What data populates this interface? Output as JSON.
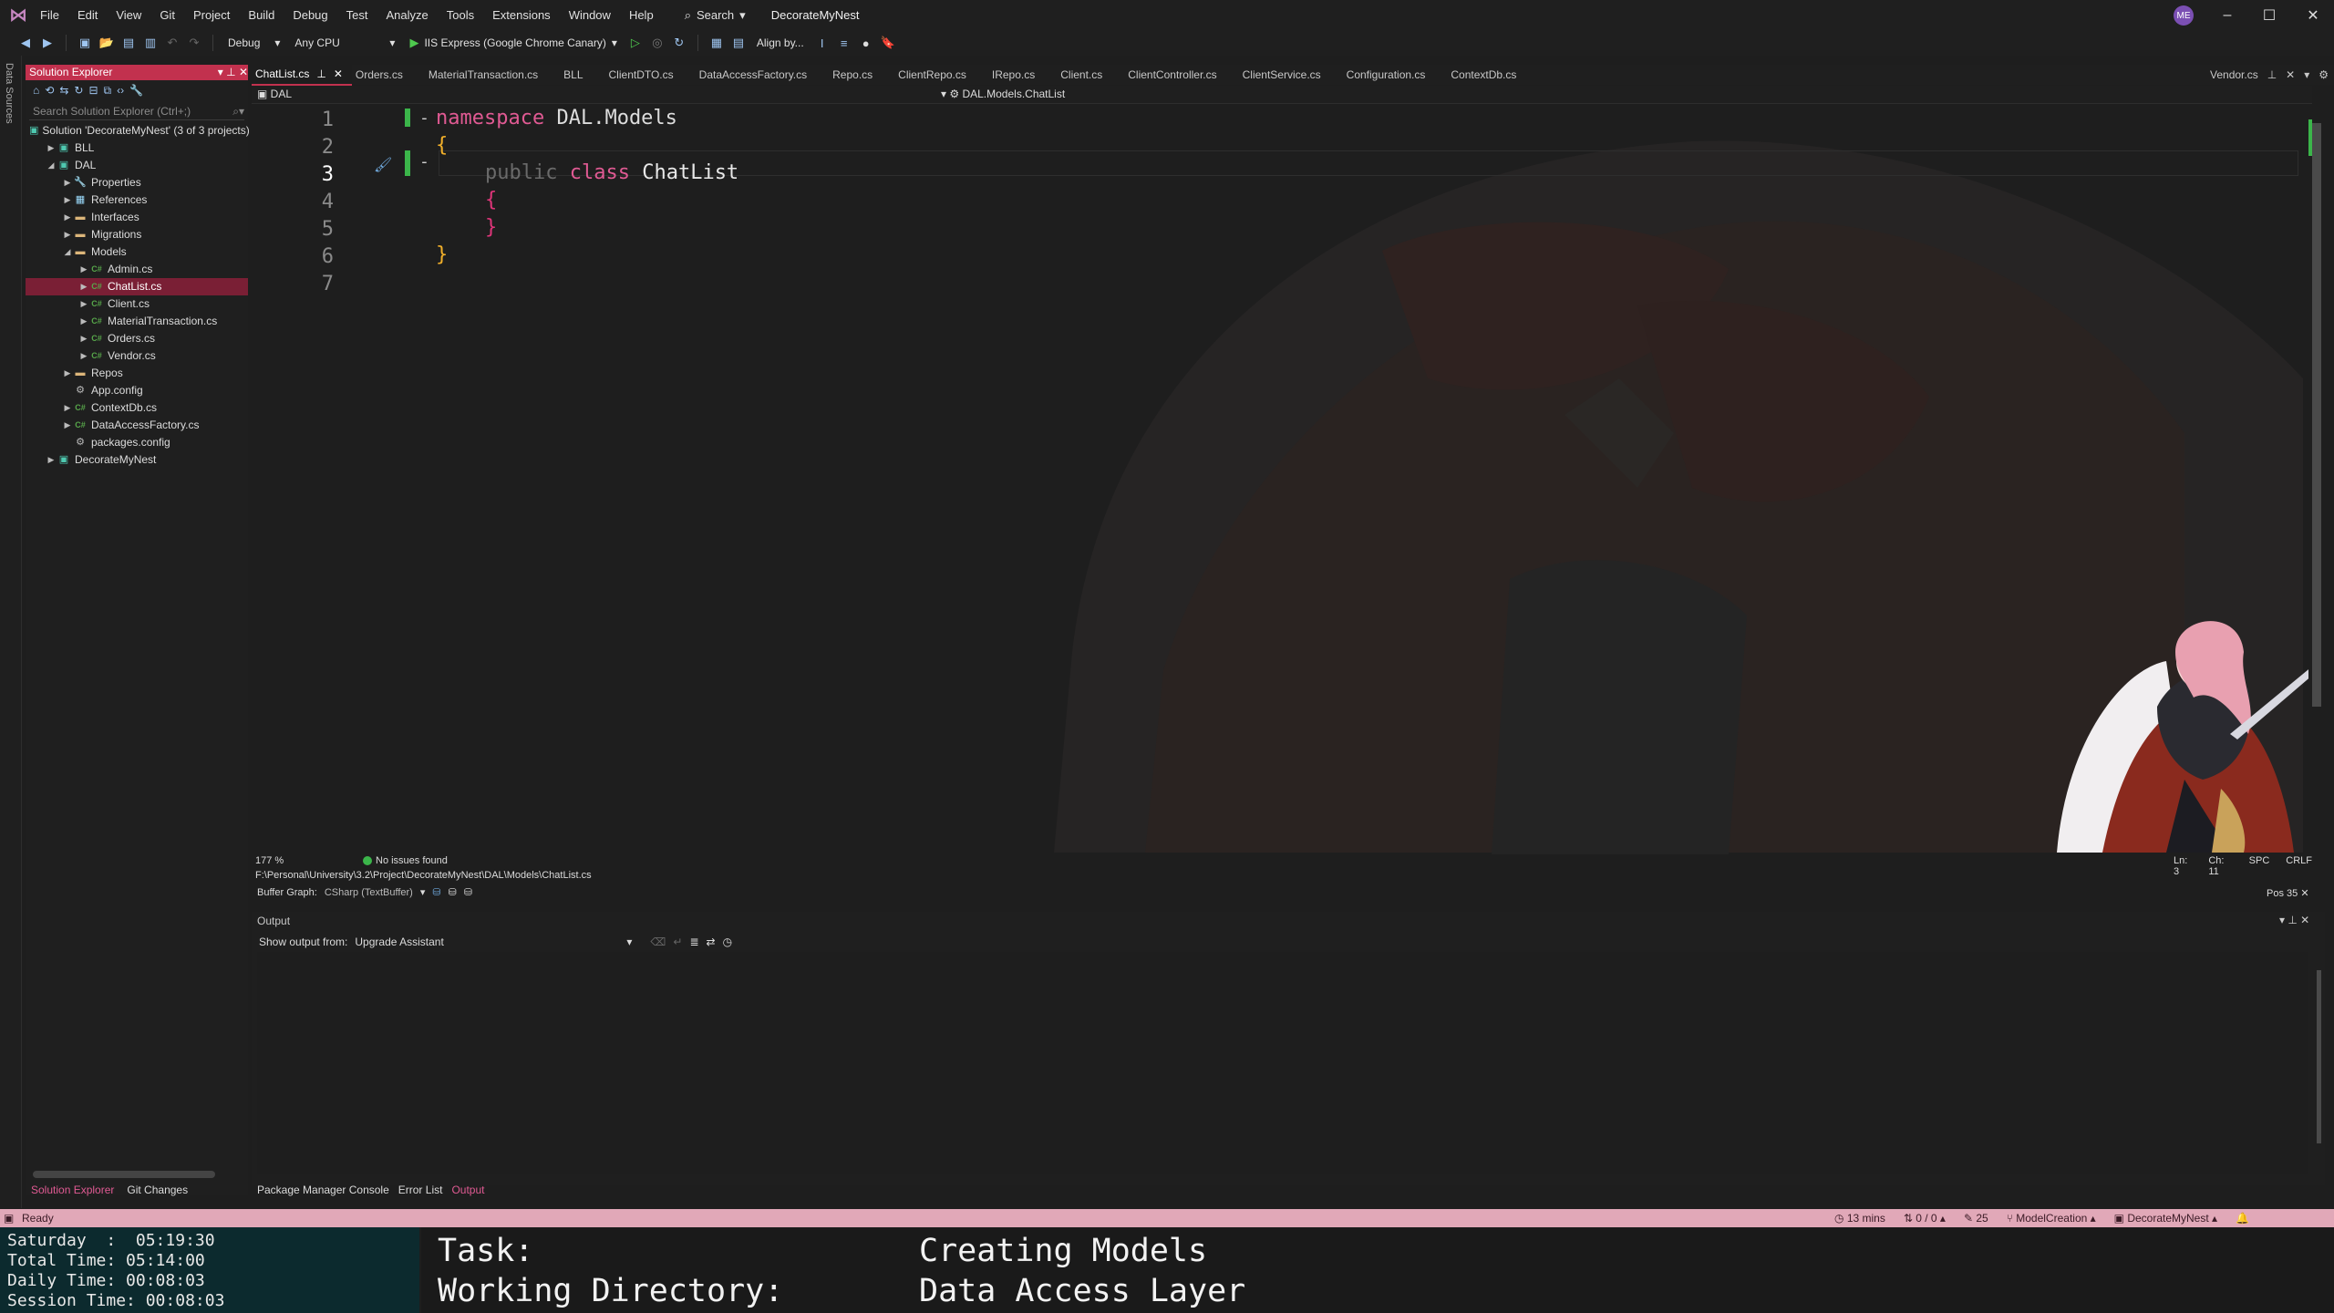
{
  "menu": [
    "File",
    "Edit",
    "View",
    "Git",
    "Project",
    "Build",
    "Debug",
    "Test",
    "Analyze",
    "Tools",
    "Extensions",
    "Window",
    "Help"
  ],
  "search_label": "Search",
  "solution_name": "DecorateMyNest",
  "user_initials": "ME",
  "toolbar": {
    "config": "Debug",
    "platform": "Any CPU",
    "run_target": "IIS Express (Google Chrome Canary)",
    "align": "Align by..."
  },
  "left_strip_label": "Data Sources",
  "solution_explorer": {
    "title": "Solution Explorer",
    "search_placeholder": "Search Solution Explorer (Ctrl+;)",
    "tree": [
      {
        "label": "Solution 'DecorateMyNest' (3 of 3 projects)",
        "indent": 0,
        "icon": "solution-icon",
        "tri": ""
      },
      {
        "label": "BLL",
        "indent": 1,
        "icon": "csharp-project-icon",
        "tri": "▶"
      },
      {
        "label": "DAL",
        "indent": 1,
        "icon": "csharp-project-icon",
        "tri": "◢"
      },
      {
        "label": "Properties",
        "indent": 2,
        "icon": "wrench-icon",
        "tri": "▶"
      },
      {
        "label": "References",
        "indent": 2,
        "icon": "references-icon",
        "tri": "▶"
      },
      {
        "label": "Interfaces",
        "indent": 2,
        "icon": "folder-icon",
        "tri": "▶"
      },
      {
        "label": "Migrations",
        "indent": 2,
        "icon": "folder-icon",
        "tri": "▶"
      },
      {
        "label": "Models",
        "indent": 2,
        "icon": "folder-open-icon",
        "tri": "◢"
      },
      {
        "label": "Admin.cs",
        "indent": 3,
        "icon": "csharp-file-icon",
        "tri": "▶"
      },
      {
        "label": "ChatList.cs",
        "indent": 3,
        "icon": "csharp-file-icon",
        "tri": "▶",
        "selected": true
      },
      {
        "label": "Client.cs",
        "indent": 3,
        "icon": "csharp-file-icon",
        "tri": "▶"
      },
      {
        "label": "MaterialTransaction.cs",
        "indent": 3,
        "icon": "csharp-file-icon",
        "tri": "▶"
      },
      {
        "label": "Orders.cs",
        "indent": 3,
        "icon": "csharp-file-icon",
        "tri": "▶"
      },
      {
        "label": "Vendor.cs",
        "indent": 3,
        "icon": "csharp-file-icon",
        "tri": "▶"
      },
      {
        "label": "Repos",
        "indent": 2,
        "icon": "folder-icon",
        "tri": "▶"
      },
      {
        "label": "App.config",
        "indent": 2,
        "icon": "config-file-icon",
        "tri": ""
      },
      {
        "label": "ContextDb.cs",
        "indent": 2,
        "icon": "csharp-file-icon",
        "tri": "▶"
      },
      {
        "label": "DataAccessFactory.cs",
        "indent": 2,
        "icon": "csharp-file-icon",
        "tri": "▶"
      },
      {
        "label": "packages.config",
        "indent": 2,
        "icon": "config-file-icon",
        "tri": ""
      },
      {
        "label": "DecorateMyNest",
        "indent": 1,
        "icon": "web-project-icon",
        "tri": "▶"
      }
    ],
    "bottom_tabs": [
      "Solution Explorer",
      "Git Changes"
    ]
  },
  "doc_tabs": [
    "ChatList.cs",
    "Orders.cs",
    "MaterialTransaction.cs",
    "BLL",
    "ClientDTO.cs",
    "DataAccessFactory.cs",
    "Repo.cs",
    "ClientRepo.cs",
    "IRepo.cs",
    "Client.cs",
    "ClientController.cs",
    "ClientService.cs",
    "Configuration.cs",
    "ContextDb.cs"
  ],
  "pinned_tab": "Vendor.cs",
  "nav_bar": {
    "project": "DAL",
    "member": "DAL.Models.ChatList"
  },
  "editor": {
    "line_numbers": [
      "1",
      "2",
      "3",
      "4",
      "5",
      "6",
      "7"
    ],
    "current_line": "3",
    "tokens": {
      "namespace_kw": "namespace",
      "namespace_name": "DAL.Models",
      "public_kw": "public",
      "class_kw": "class",
      "class_name": "ChatList",
      "open_brace": "{",
      "close_brace": "}"
    }
  },
  "editor_status": {
    "zoom": "177 %",
    "issues": "No issues found",
    "ln": "Ln: 3",
    "ch": "Ch: 11",
    "spc": "SPC",
    "eol": "CRLF"
  },
  "file_path": "F:\\Personal\\University\\3.2\\Project\\DecorateMyNest\\DAL\\Models\\ChatList.cs",
  "buffer_graph": {
    "label": "Buffer Graph:",
    "value": "CSharp (TextBuffer)"
  },
  "pos_label": "Pos 35",
  "output": {
    "title": "Output",
    "show_from_label": "Show output from:",
    "show_from_value": "Upgrade Assistant"
  },
  "bottom_tabs": [
    "Package Manager Console",
    "Error List",
    "Output"
  ],
  "status_bar": {
    "ready": "Ready",
    "time": "13 mins",
    "sync": "0 / 0",
    "edits": "25",
    "branch": "ModelCreation",
    "repo": "DecorateMyNest"
  },
  "overlay": {
    "day_line": "Saturday  :  05:19:30",
    "total_line": "Total Time: 05:14:00",
    "daily_line": "Daily Time: 00:08:03",
    "session_line": "Session Time: 00:08:03",
    "task_label": "Task:",
    "task_value": "Creating Models",
    "wd_label": "Working Directory:",
    "wd_value": "Data Access Layer"
  },
  "colors": {
    "accent": "#c2314e",
    "status_bar": "#e1a8b8",
    "keyword": "#e05a93",
    "git_added": "#3bb54a"
  }
}
